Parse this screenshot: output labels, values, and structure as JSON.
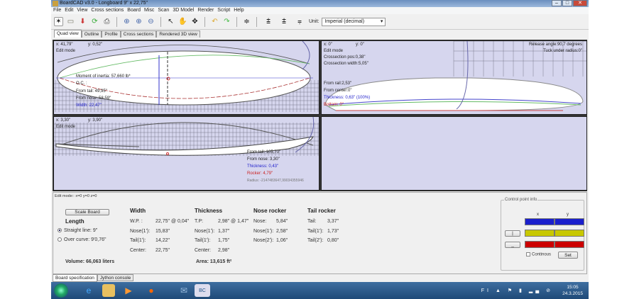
{
  "window": {
    "title": "BoardCAD v3.0 - Longboard  9\" x 22,75\""
  },
  "menu": [
    "File",
    "Edit",
    "View",
    "Cross sections",
    "Board",
    "Misc",
    "Scan",
    "3D Model",
    "Render",
    "Script",
    "Help"
  ],
  "toolbar": {
    "unit_label": "Unit:",
    "unit_value": "Imperial (decimal)"
  },
  "tabs": [
    "Quad view",
    "Outline",
    "Profile",
    "Cross sections",
    "Rendered 3D view"
  ],
  "outline_view": {
    "x": "x: 41,79\"",
    "y": "y: 0,52\"",
    "mode": "Edit mode",
    "moment": "Moment of inertia: 57,660 lb*",
    "oc": "O.C. :",
    "from_tail": "From tail: 49,95\"",
    "from_nose": "From nose: 58,59\"",
    "width": "Width: 22,47\""
  },
  "cross_view": {
    "x": "x: 0\"",
    "y": "y: 0\"",
    "mode": "Edit mode",
    "crosspos": "Crossection pos:0,38\"",
    "crosswidth": "Crossection width:5,05\"",
    "release": "Release angle:90,7 degrees",
    "tuck": "Tuck under radius:0\"",
    "from_rail": "From rail:2,53\"",
    "from_center": "From center:0\"",
    "thickness": "Thickness: 0,63\" (100%)",
    "bottom": "Bottom: 0\""
  },
  "profile_view": {
    "x": "x: 3,30\"",
    "y": "y: 3,90\"",
    "mode": "Edit mode",
    "from_tail": "From tail: 105,70\"",
    "from_nose": "From nose: 3,30\"",
    "thickness": "Thickness: 0,43\"",
    "rocker": "Rocker: 4,79\"",
    "radius": "Radius: -2147483647,99034355946"
  },
  "spec": {
    "edit_mode": "Edit mode:: x=0 y=0 z=0",
    "scale_button": "Scale Board",
    "length_title": "Length",
    "straight": "Straight line: 9\"",
    "over_curve": "Over curve: 9'0,76\"",
    "volume": "Volume: 66,063 liters",
    "width": {
      "title": "Width",
      "rows": [
        [
          "W.P. :",
          "22,75\" @ 0,04\""
        ],
        [
          "Nose(1'):",
          "15,83\""
        ],
        [
          "Tail(1'):",
          "14,22\""
        ],
        [
          "Center:",
          "22,75\""
        ]
      ]
    },
    "thickness": {
      "title": "Thickness",
      "rows": [
        [
          "T.P:",
          "2,98\" @ 1,47\""
        ],
        [
          "Nose(1'):",
          "1,37\""
        ],
        [
          "Tail(1'):",
          "1,75\""
        ],
        [
          "Center:",
          "2,98\""
        ]
      ],
      "area": "Area: 13,615 ft²"
    },
    "nose_rocker": {
      "title": "Nose rocker",
      "rows": [
        [
          "Nose:",
          "5,84\""
        ],
        [
          "Nose(1'):",
          "2,58\""
        ],
        [
          "Nose(2'):",
          "1,06\""
        ]
      ]
    },
    "tail_rocker": {
      "title": "Tail rocker",
      "rows": [
        [
          "Tail:",
          "3,37\""
        ],
        [
          "Tail(1'):",
          "1,73\""
        ],
        [
          "Tail(2'):",
          "0,80\""
        ]
      ]
    }
  },
  "control_point": {
    "title": "Control point info",
    "x": "x",
    "y": "y",
    "continuous": "Continous",
    "set": "Set",
    "colors": [
      "#1a1fcc",
      "#c8c800",
      "#cc0000"
    ]
  },
  "bottom_tabs": [
    "Board specification",
    "Jython console"
  ],
  "taskbar": {
    "time": "15:05",
    "date": "24.3.2015",
    "lang": "FI"
  }
}
